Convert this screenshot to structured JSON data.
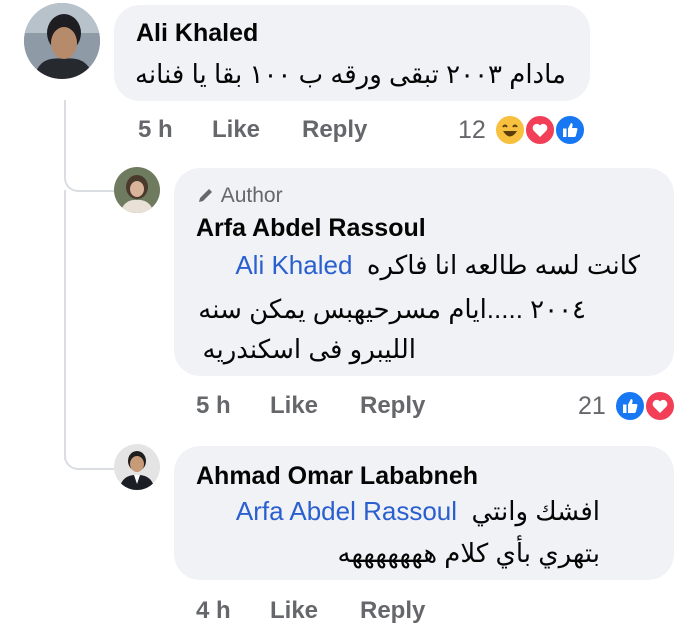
{
  "comments": [
    {
      "author": "Ali Khaled",
      "text": "مادام ٢٠٠٣ تبقى ورقه ب ١٠٠ بقا يا فنانه",
      "time": "5 h",
      "like": "Like",
      "reply": "Reply",
      "reaction_count": "12",
      "reactions": [
        "haha-icon",
        "love-icon",
        "like-icon"
      ]
    },
    {
      "badge": "Author",
      "author": "Arfa Abdel Rassoul",
      "mention": "Ali Khaled",
      "line1": "كانت لسه طالعه انا فاكره",
      "line2": "٢٠٠٤ .....ايام مسرحيهبس يمكن سنه",
      "line3": "الليبرو فى اسكندريه",
      "time": "5 h",
      "like": "Like",
      "reply": "Reply",
      "reaction_count": "21",
      "reactions": [
        "like-icon",
        "love-icon"
      ]
    },
    {
      "author": "Ahmad Omar Lababneh",
      "mention": "Arfa Abdel Rassoul",
      "line1": "افشك وانتي",
      "line2": "بتهري بأي كلام هههههههه",
      "time": "4 h",
      "like": "Like",
      "reply": "Reply"
    }
  ],
  "colors": {
    "bubble": "#f0f2f5",
    "mention": "#2a5fd0",
    "muted": "#65676b",
    "like_blue": "#1877f2",
    "love_red": "#f33e58",
    "haha_yellow": "#f7c13f"
  }
}
